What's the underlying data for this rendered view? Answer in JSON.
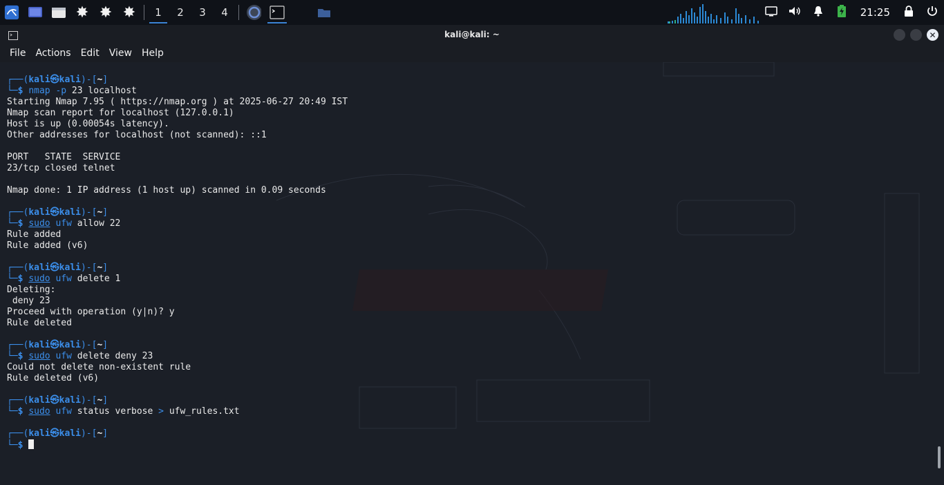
{
  "panel": {
    "workspaces": [
      "1",
      "2",
      "3",
      "4"
    ],
    "active_workspace": "1",
    "clock": "21:25",
    "icons": [
      "kali-menu-icon",
      "desktop-icon",
      "files-icon",
      "settings-icon-1",
      "settings-icon-2",
      "settings-icon-3",
      "browser-icon",
      "terminal-icon",
      "folder-icon"
    ]
  },
  "window": {
    "title": "kali@kali: ~",
    "menu": [
      "File",
      "Actions",
      "Edit",
      "View",
      "Help"
    ]
  },
  "terminal": {
    "user": "kali",
    "host": "kali",
    "dir": "~",
    "blocks": [
      {
        "command_parts": [
          {
            "text": "nmap",
            "style": "blue"
          },
          {
            "text": " -p",
            "style": "blue"
          },
          {
            "text": " 23 localhost",
            "style": "plain"
          }
        ],
        "output": [
          "Starting Nmap 7.95 ( https://nmap.org ) at 2025-06-27 20:49 IST",
          "Nmap scan report for localhost (127.0.0.1)",
          "Host is up (0.00054s latency).",
          "Other addresses for localhost (not scanned): ::1",
          "",
          "PORT   STATE  SERVICE",
          "23/tcp closed telnet",
          "",
          "Nmap done: 1 IP address (1 host up) scanned in 0.09 seconds"
        ]
      },
      {
        "command_parts": [
          {
            "text": "sudo",
            "style": "blue-u"
          },
          {
            "text": " ",
            "style": "plain"
          },
          {
            "text": "ufw",
            "style": "blue"
          },
          {
            "text": " allow 22",
            "style": "plain"
          }
        ],
        "output": [
          "Rule added",
          "Rule added (v6)"
        ]
      },
      {
        "command_parts": [
          {
            "text": "sudo",
            "style": "blue-u"
          },
          {
            "text": " ",
            "style": "plain"
          },
          {
            "text": "ufw",
            "style": "blue"
          },
          {
            "text": " delete 1",
            "style": "plain"
          }
        ],
        "output": [
          "Deleting:",
          " deny 23",
          "Proceed with operation (y|n)? y",
          "Rule deleted"
        ]
      },
      {
        "command_parts": [
          {
            "text": "sudo",
            "style": "blue-u"
          },
          {
            "text": " ",
            "style": "plain"
          },
          {
            "text": "ufw",
            "style": "blue"
          },
          {
            "text": " delete deny 23",
            "style": "plain"
          }
        ],
        "output": [
          "Could not delete non-existent rule",
          "Rule deleted (v6)"
        ]
      },
      {
        "command_parts": [
          {
            "text": "sudo",
            "style": "blue-u"
          },
          {
            "text": " ",
            "style": "plain"
          },
          {
            "text": "ufw",
            "style": "blue"
          },
          {
            "text": " status verbose ",
            "style": "plain"
          },
          {
            "text": ">",
            "style": "blue"
          },
          {
            "text": " ufw_rules.txt",
            "style": "plain"
          }
        ],
        "output": []
      }
    ]
  },
  "colors": {
    "prompt_blue": "#3b8eea",
    "background": "#1b1f27",
    "accent": "#3b84d6"
  }
}
